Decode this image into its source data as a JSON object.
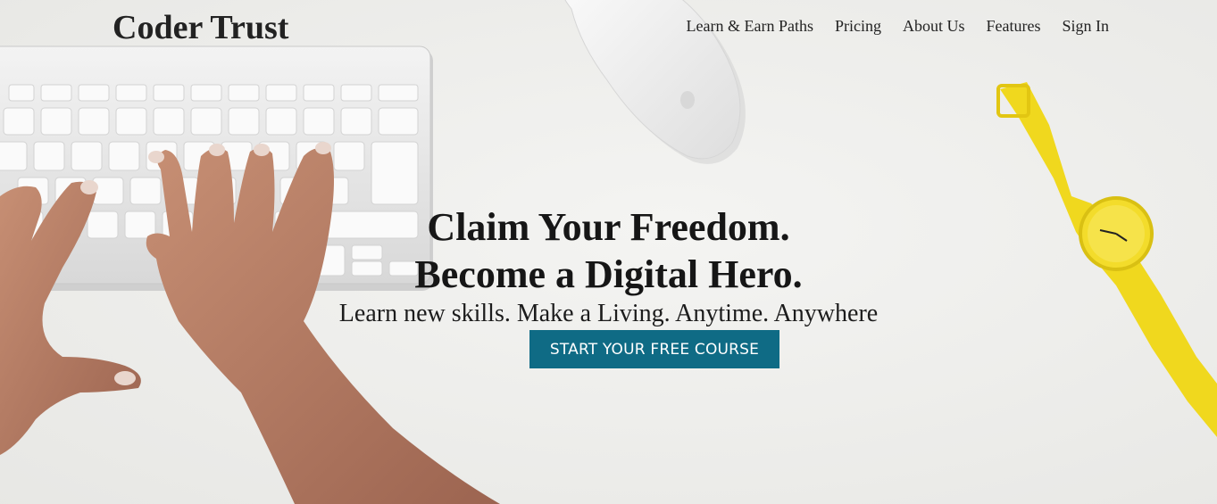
{
  "header": {
    "brand": "Coder Trust",
    "nav": [
      {
        "label": "Learn & Earn Paths"
      },
      {
        "label": "Pricing"
      },
      {
        "label": "About Us"
      },
      {
        "label": "Features"
      },
      {
        "label": "Sign In"
      }
    ]
  },
  "hero": {
    "headline_line1": "Claim Your Freedom.",
    "headline_line2": "Become a Digital Hero.",
    "tagline": "Learn new skills. Make a Living. Anytime. Anywhere",
    "cta_label": "START YOUR FREE COURSE",
    "background_image": "desk-photo-keyboard-hands-mouse-watch"
  },
  "colors": {
    "cta_background": "#0f6b85",
    "cta_text": "#ffffff",
    "page_background": "#eeeeec",
    "watch": "#f0d81e"
  }
}
